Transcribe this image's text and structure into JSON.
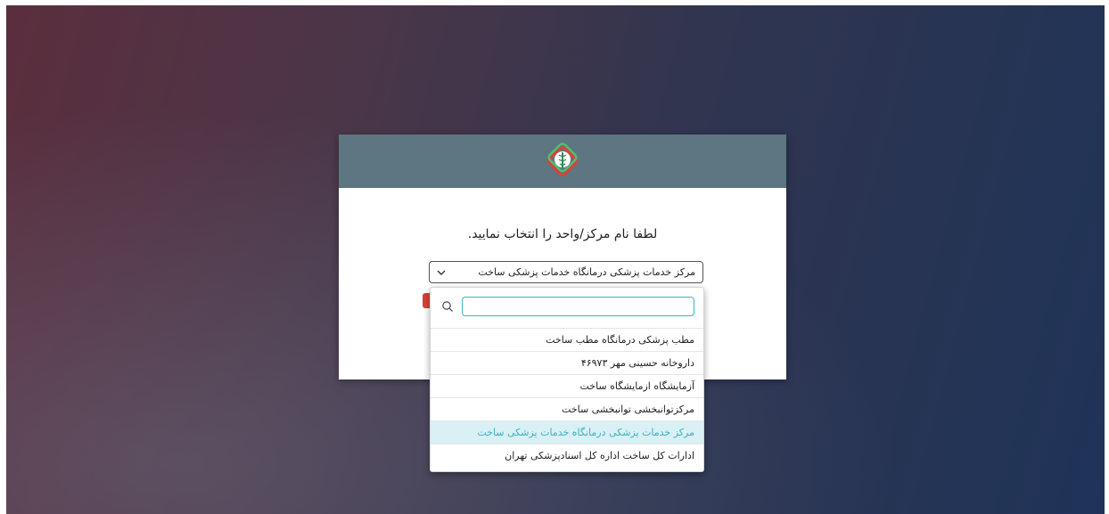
{
  "page": {
    "prompt": "لطفا نام مرکز/واحد را انتخاب نمایید.",
    "logo_icon": "medical-caduceus-logo",
    "header_color": "#5d7681",
    "accent_color": "#38b6c8",
    "button_color": "#d9413a"
  },
  "select": {
    "value": "مرکز خدمات پزشکی درمانگاه خدمات پزشکی ساخت",
    "chevron_icon": "chevron-down-icon"
  },
  "dropdown": {
    "search_placeholder": "",
    "search_icon": "search-icon",
    "options": [
      {
        "label": "مطب پزشکی درمانگاه مطب ساخت",
        "selected": false
      },
      {
        "label": "داروخانه حسینی مهر ۴۶۹۷۳",
        "selected": false
      },
      {
        "label": "آزمایشگاه ازمایشگاه ساخت",
        "selected": false
      },
      {
        "label": "مرکزتوانبخشی توانبخشی ساخت",
        "selected": false
      },
      {
        "label": "مرکز خدمات پزشکی درمانگاه خدمات پزشکی ساخت",
        "selected": true
      },
      {
        "label": "ادارات کل ساخت اداره کل اسنادپزشکی تهران",
        "selected": false
      }
    ]
  }
}
